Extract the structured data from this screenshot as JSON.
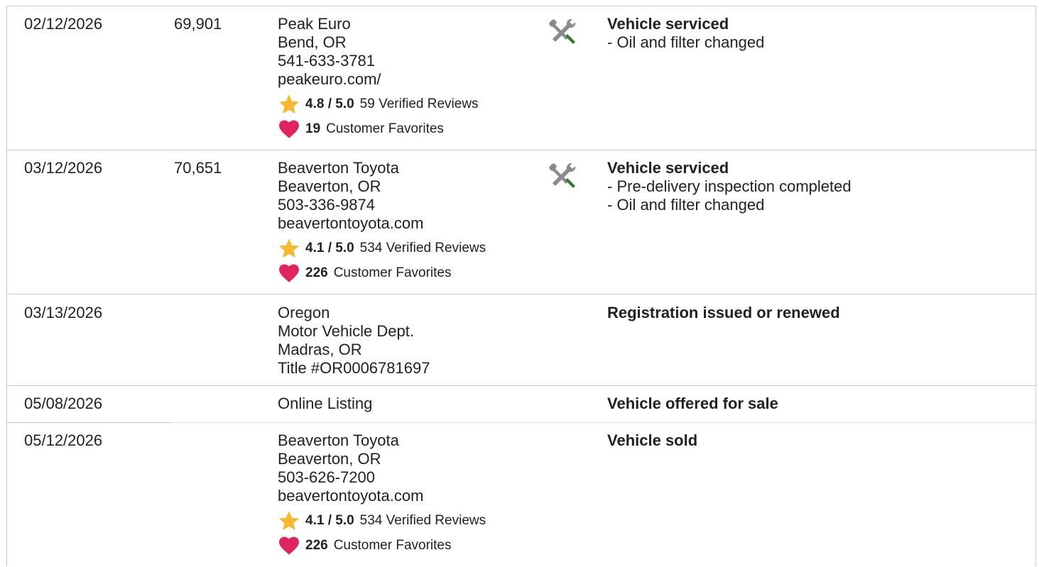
{
  "records": [
    {
      "date": "02/12/2026",
      "odometer": "69,901",
      "source": [
        "Peak Euro",
        "Bend, OR",
        "541-633-3781",
        "peakeuro.com/"
      ],
      "rating": "4.8 / 5.0",
      "reviews": "59 Verified Reviews",
      "favorites_count": "19",
      "favorites_label": "Customer Favorites",
      "icon": "service-tools-icon",
      "event_title": "Vehicle serviced",
      "event_items": [
        "- Oil and filter changed"
      ]
    },
    {
      "date": "03/12/2026",
      "odometer": "70,651",
      "source": [
        "Beaverton Toyota",
        "Beaverton, OR",
        "503-336-9874",
        "beavertontoyota.com"
      ],
      "rating": "4.1 / 5.0",
      "reviews": "534 Verified Reviews",
      "favorites_count": "226",
      "favorites_label": "Customer Favorites",
      "icon": "service-tools-icon",
      "event_title": "Vehicle serviced",
      "event_items": [
        "- Pre-delivery inspection completed",
        "- Oil and filter changed"
      ]
    },
    {
      "date": "03/13/2026",
      "odometer": "",
      "source": [
        "Oregon",
        "Motor Vehicle Dept.",
        "Madras, OR",
        "Title #OR0006781697"
      ],
      "event_title": "Registration issued or renewed",
      "event_items": []
    },
    {
      "date": "05/08/2026",
      "odometer": "",
      "source": [
        "Online Listing"
      ],
      "event_title": "Vehicle offered for sale",
      "event_items": []
    },
    {
      "date": "05/12/2026",
      "odometer": "",
      "source": [
        "Beaverton Toyota",
        "Beaverton, OR",
        "503-626-7200",
        "beavertontoyota.com"
      ],
      "rating": "4.1 / 5.0",
      "reviews": "534 Verified Reviews",
      "favorites_count": "226",
      "favorites_label": "Customer Favorites",
      "event_title": "Vehicle sold",
      "event_items": []
    }
  ],
  "colors": {
    "star": "#f5b82e",
    "heart": "#e0245e",
    "tool_gray": "#8a8a8a",
    "tool_green": "#2e7d32",
    "border": "#c8c8c8"
  }
}
